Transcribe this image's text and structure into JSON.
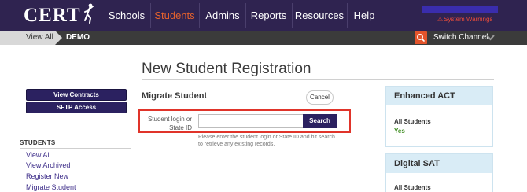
{
  "app": {
    "logo_text": "CERT"
  },
  "nav": {
    "items": [
      {
        "label": "Schools"
      },
      {
        "label": "Students",
        "active": true
      },
      {
        "label": "Admins"
      },
      {
        "label": "Reports"
      },
      {
        "label": "Resources"
      },
      {
        "label": "Help"
      }
    ],
    "warnings_label": "System Warnings"
  },
  "breadcrumb": {
    "items": [
      "View All",
      "DEMO"
    ],
    "switch_channel_label": "Switch Channel"
  },
  "page": {
    "title": "New Student Registration"
  },
  "sidebar": {
    "buttons": [
      "View Contracts",
      "SFTP Access"
    ],
    "section_title": "STUDENTS",
    "links": [
      "View All",
      "View Archived",
      "Register New",
      "Migrate Student"
    ]
  },
  "migrate": {
    "section_title": "Migrate Student",
    "cancel_label": "Cancel",
    "field_label": "Student login or State ID",
    "field_value": "",
    "search_label": "Search",
    "help_text": "Please enter the student login or State ID and hit search to retrieve any existing records."
  },
  "panels": [
    {
      "title": "Enhanced ACT",
      "label": "All Students",
      "value": "Yes"
    },
    {
      "title": "Digital SAT",
      "label": "All Students",
      "value": ""
    }
  ],
  "colors": {
    "nav_bg": "#2f2350",
    "accent": "#e5622d",
    "button_bg": "#2b2160",
    "highlight": "#e0342a",
    "yes_green": "#3a8a1c",
    "panel_header": "#d9ecf6"
  }
}
